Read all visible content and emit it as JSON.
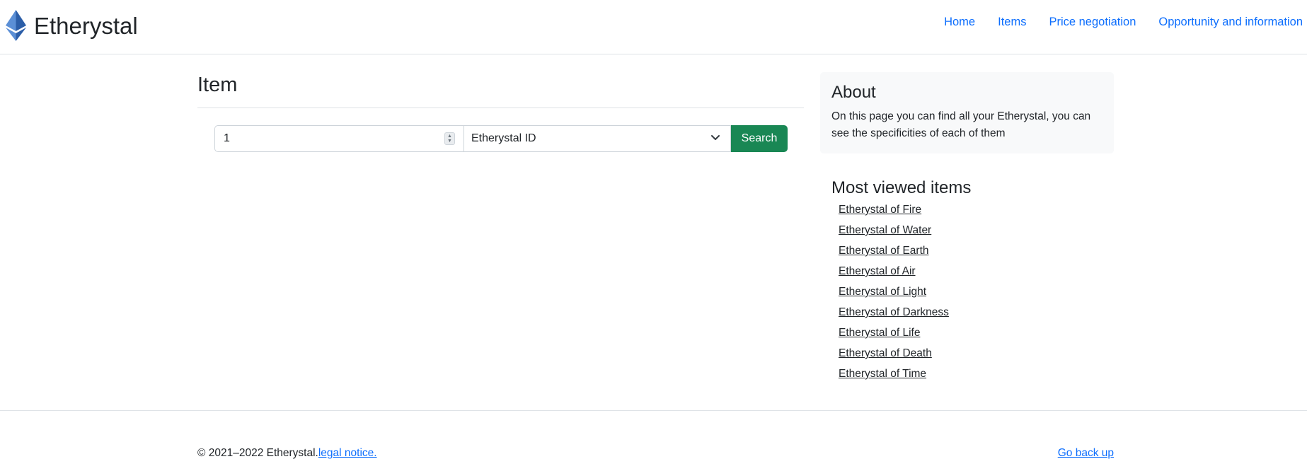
{
  "brand": {
    "name": "Etherystal",
    "logo_icon": "ethereum-diamond-icon"
  },
  "nav": {
    "items": [
      {
        "label": "Home"
      },
      {
        "label": "Items"
      },
      {
        "label": "Price negotiation"
      },
      {
        "label": "Opportunity and information"
      }
    ]
  },
  "main": {
    "title": "Item",
    "search": {
      "number_value": "1",
      "select_value": "Etherystal ID",
      "button_label": "Search"
    }
  },
  "sidebar": {
    "about_title": "About",
    "about_text": "On this page you can find all your Etherystal, you can see the specificities of each of them",
    "most_viewed_title": "Most viewed items",
    "most_viewed": [
      "Etherystal of Fire",
      "Etherystal of Water",
      "Etherystal of Earth",
      "Etherystal of Air",
      "Etherystal of Light",
      "Etherystal of Darkness",
      "Etherystal of Life",
      "Etherystal of Death",
      "Etherystal of Time"
    ]
  },
  "footer": {
    "copyright": "© 2021–2022 Etherystal.",
    "legal_link": "legal notice.",
    "back_up": "Go back up"
  },
  "colors": {
    "primary": "#0d6efd",
    "success": "#198754",
    "logo_blue": "#3b6db4"
  }
}
